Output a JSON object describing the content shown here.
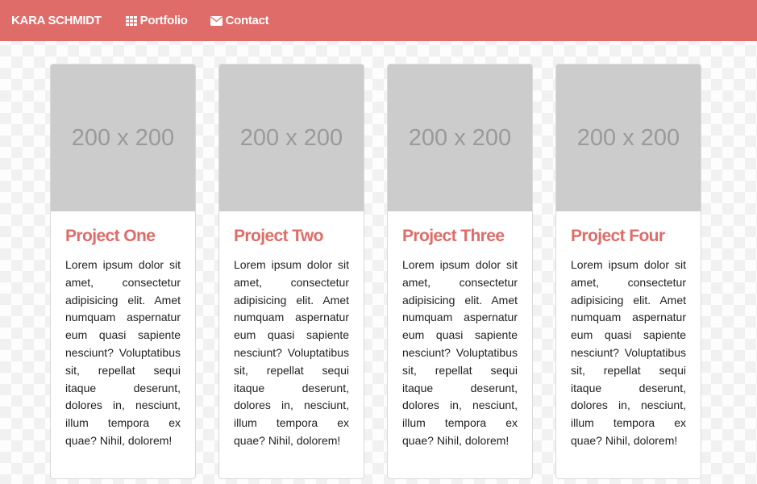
{
  "navbar": {
    "brand": "KARA SCHMIDT",
    "links": [
      {
        "label": "Portfolio",
        "icon": "grid-icon"
      },
      {
        "label": "Contact",
        "icon": "envelope-icon"
      }
    ],
    "background": "#df6c68"
  },
  "projects": [
    {
      "image_label": "200 x 200",
      "title": "Project One",
      "text": "Lorem ipsum dolor sit amet, consectetur adipisicing elit. Amet numquam aspernatur eum quasi sapiente nesciunt? Voluptatibus sit, repellat sequi itaque deserunt, dolores in, nesciunt, illum tempora ex quae? Nihil, dolorem!"
    },
    {
      "image_label": "200 x 200",
      "title": "Project Two",
      "text": "Lorem ipsum dolor sit amet, consectetur adipisicing elit. Amet numquam aspernatur eum quasi sapiente nesciunt? Voluptatibus sit, repellat sequi itaque deserunt, dolores in, nesciunt, illum tempora ex quae? Nihil, dolorem!"
    },
    {
      "image_label": "200 x 200",
      "title": "Project Three",
      "text": "Lorem ipsum dolor sit amet, consectetur adipisicing elit. Amet numquam aspernatur eum quasi sapiente nesciunt? Voluptatibus sit, repellat sequi itaque deserunt, dolores in, nesciunt, illum tempora ex quae? Nihil, dolorem!"
    },
    {
      "image_label": "200 x 200",
      "title": "Project Four",
      "text": "Lorem ipsum dolor sit amet, consectetur adipisicing elit. Amet numquam aspernatur eum quasi sapiente nesciunt? Voluptatibus sit, repellat sequi itaque deserunt, dolores in, nesciunt, illum tempora ex quae? Nihil, dolorem!"
    }
  ],
  "colors": {
    "accent": "#df6c68",
    "placeholder": "#cccccc",
    "placeholder_text": "#9a9a9a"
  }
}
